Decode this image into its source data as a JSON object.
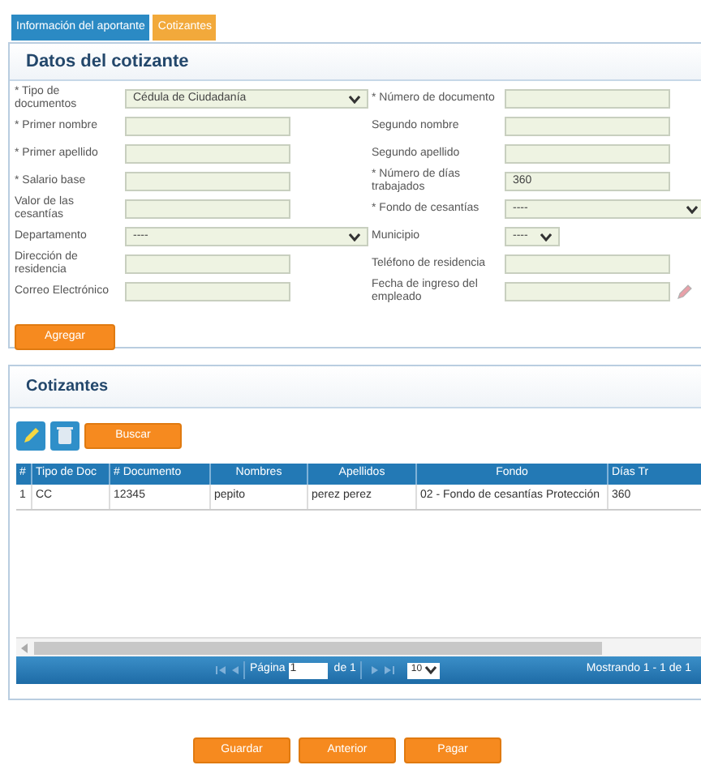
{
  "tabs": [
    {
      "label": "Información del aportante",
      "selected": false
    },
    {
      "label": "Cotizantes",
      "selected": true
    }
  ],
  "form": {
    "title": "Datos del cotizante",
    "rows": [
      {
        "left": {
          "label": "* Tipo de documentos",
          "kind": "select",
          "value": "Cédula de Ciudadanía"
        },
        "right": {
          "label": "* Número de documento",
          "kind": "input"
        }
      },
      {
        "left": {
          "label": "* Primer nombre",
          "kind": "input"
        },
        "right": {
          "label": "Segundo nombre",
          "kind": "input"
        }
      },
      {
        "left": {
          "label": "* Primer apellido",
          "kind": "input"
        },
        "right": {
          "label": "Segundo apellido",
          "kind": "input"
        }
      },
      {
        "left": {
          "label": "* Salario base",
          "kind": "input"
        },
        "right": {
          "label": "* Número de días trabajados",
          "kind": "input",
          "value": "360"
        }
      },
      {
        "left": {
          "label": "Valor de las cesantías",
          "kind": "input"
        },
        "right": {
          "label": "* Fondo de cesantías",
          "kind": "wide-select",
          "value": "----"
        }
      },
      {
        "left": {
          "label": "Departamento",
          "kind": "select",
          "value": "----"
        },
        "right": {
          "label": "Municipio",
          "kind": "small-select",
          "value": "----"
        }
      },
      {
        "left": {
          "label": "Dirección de residencia",
          "kind": "input"
        },
        "right": {
          "label": "Teléfono de residencia",
          "kind": "input"
        }
      },
      {
        "left": {
          "label": "Correo Electrónico",
          "kind": "input"
        },
        "right": {
          "label": "Fecha de ingreso del empleado",
          "kind": "date"
        }
      }
    ],
    "button": "Agregar"
  },
  "grid": {
    "title": "Cotizantes",
    "search_button": "Buscar",
    "columns": [
      "#",
      "Tipo de Doc",
      "# Documento",
      "Nombres",
      "Apellidos",
      "Fondo",
      "Días Tr"
    ],
    "rows": [
      [
        "1",
        "CC",
        "12345",
        "pepito",
        "perez perez",
        "02 - Fondo de cesantías Protección",
        "360"
      ]
    ],
    "pager": {
      "page_label": "Página",
      "page": "1",
      "of": "de 1",
      "page_size": "10",
      "summary": "Mostrando 1 - 1 de 1"
    }
  },
  "buttons": [
    "Guardar",
    "Anterior",
    "Pagar"
  ]
}
